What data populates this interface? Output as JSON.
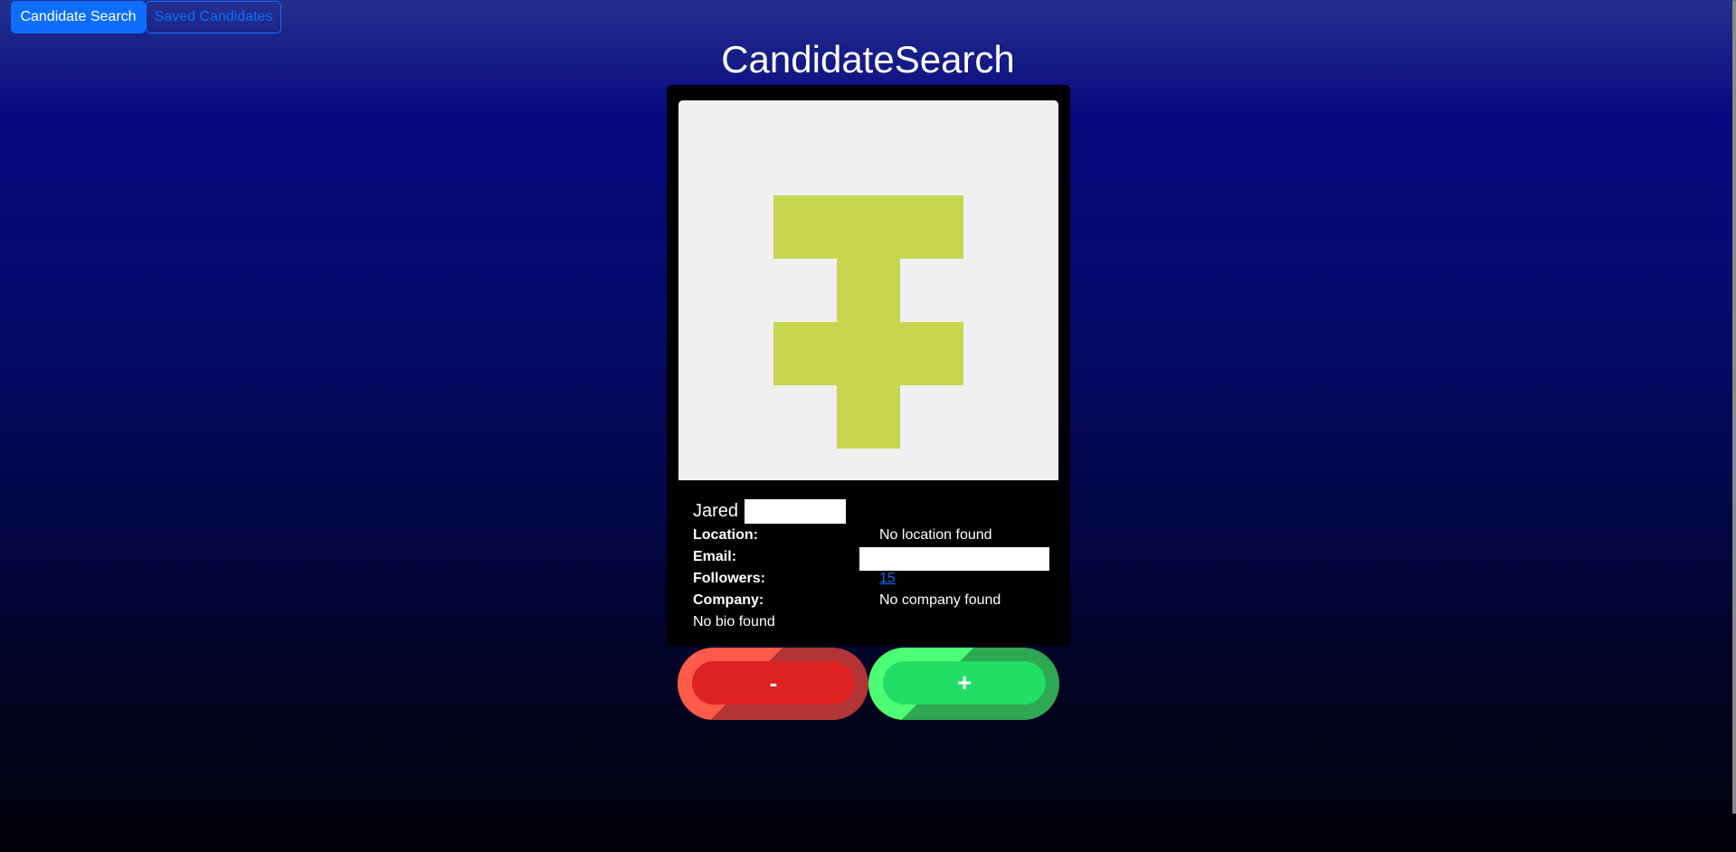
{
  "nav": {
    "items": [
      {
        "label": "Candidate Search",
        "active": true
      },
      {
        "label": "Saved Candidates",
        "active": false
      }
    ]
  },
  "page": {
    "title": "CandidateSearch"
  },
  "candidate": {
    "avatar_icon": "identicon-avatar",
    "avatar_color": "#c5d64f",
    "first_name": "Jared",
    "labels": {
      "location": "Location:",
      "email": "Email:",
      "followers": "Followers:",
      "company": "Company:"
    },
    "location": "No location found",
    "followers": "15",
    "company": "No company found",
    "bio": "No bio found"
  },
  "actions": {
    "reject_label": "-",
    "accept_label": "+"
  },
  "colors": {
    "primary": "#0d6efd",
    "reject": "#dd2222",
    "accept": "#22dd66"
  }
}
